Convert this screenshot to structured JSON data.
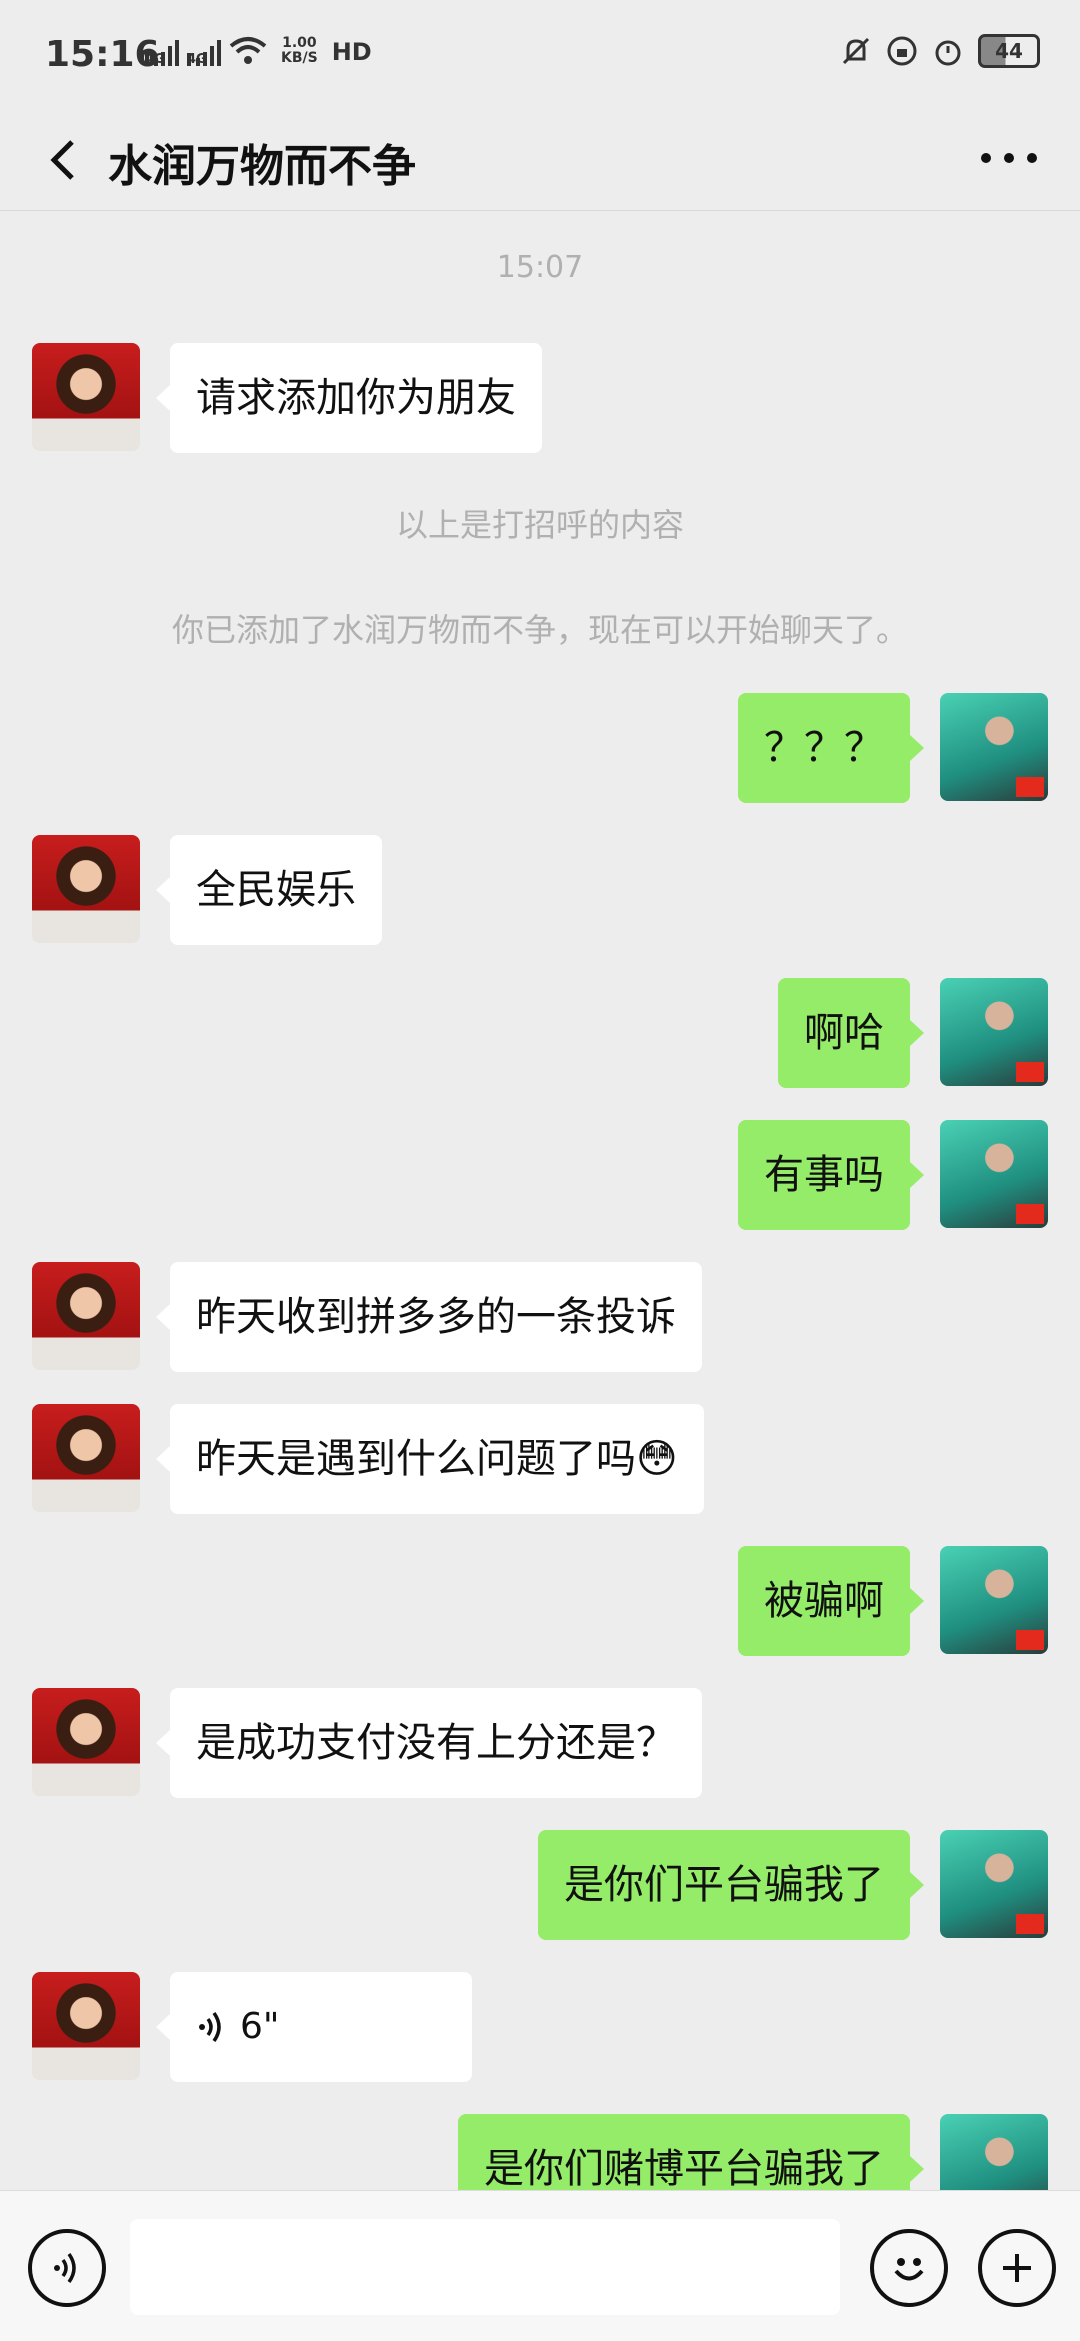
{
  "status_bar": {
    "time": "15:16",
    "network_type": "4G",
    "speed_value": "1.00",
    "speed_unit": "KB/S",
    "hd_label": "HD",
    "battery": "44"
  },
  "header": {
    "title": "水润万物而不争"
  },
  "chat": {
    "time_label": "15:07",
    "system_greeting": "以上是打招呼的内容",
    "system_added": "你已添加了水润万物而不争，现在可以开始聊天了。",
    "messages": [
      {
        "side": "left",
        "text": "请求添加你为朋友"
      },
      {
        "side": "right",
        "text": "？？？"
      },
      {
        "side": "left",
        "text": "全民娱乐"
      },
      {
        "side": "right",
        "text": "啊哈"
      },
      {
        "side": "right",
        "text": "有事吗"
      },
      {
        "side": "left",
        "text": "昨天收到拼多多的一条投诉"
      },
      {
        "side": "left",
        "text": "昨天是遇到什么问题了吗😳"
      },
      {
        "side": "right",
        "text": "被骗啊"
      },
      {
        "side": "left",
        "text": "是成功支付没有上分还是？"
      },
      {
        "side": "right",
        "text": "是你们平台骗我了"
      },
      {
        "side": "left",
        "text": "6\"",
        "type": "voice"
      },
      {
        "side": "right",
        "text": "是你们赌博平台骗我了"
      }
    ]
  },
  "icons": {
    "back": "chevron-left-icon",
    "more": "more-dots-icon",
    "voice": "voice-icon",
    "emoji": "emoji-icon",
    "plus": "plus-icon"
  },
  "colors": {
    "background": "#ededed",
    "bubble_self": "#95ec69",
    "bubble_other": "#ffffff"
  }
}
